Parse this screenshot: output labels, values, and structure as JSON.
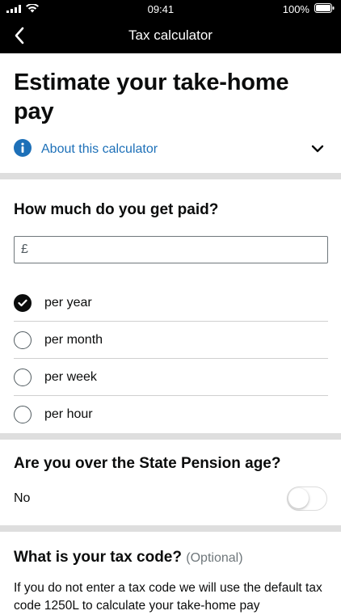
{
  "status_bar": {
    "time": "09:41",
    "battery": "100%"
  },
  "nav": {
    "title": "Tax calculator"
  },
  "header": {
    "title": "Estimate your take-home pay",
    "about_label": "About this calculator"
  },
  "pay": {
    "question": "How much do you get paid?",
    "currency_symbol": "£",
    "input_value": "",
    "options": [
      {
        "label": "per year",
        "selected": true
      },
      {
        "label": "per month",
        "selected": false
      },
      {
        "label": "per week",
        "selected": false
      },
      {
        "label": "per hour",
        "selected": false
      }
    ]
  },
  "pension": {
    "question": "Are you over the State Pension age?",
    "answer": "No",
    "toggle_on": false
  },
  "tax_code": {
    "question": "What is your tax code?",
    "optional_label": "(Optional)",
    "description": "If you do not enter a tax code we will use the default tax code 1250L to calculate your take-home pay"
  },
  "colors": {
    "link": "#1d70b8",
    "bar": "#000000",
    "divider": "#dedede"
  }
}
